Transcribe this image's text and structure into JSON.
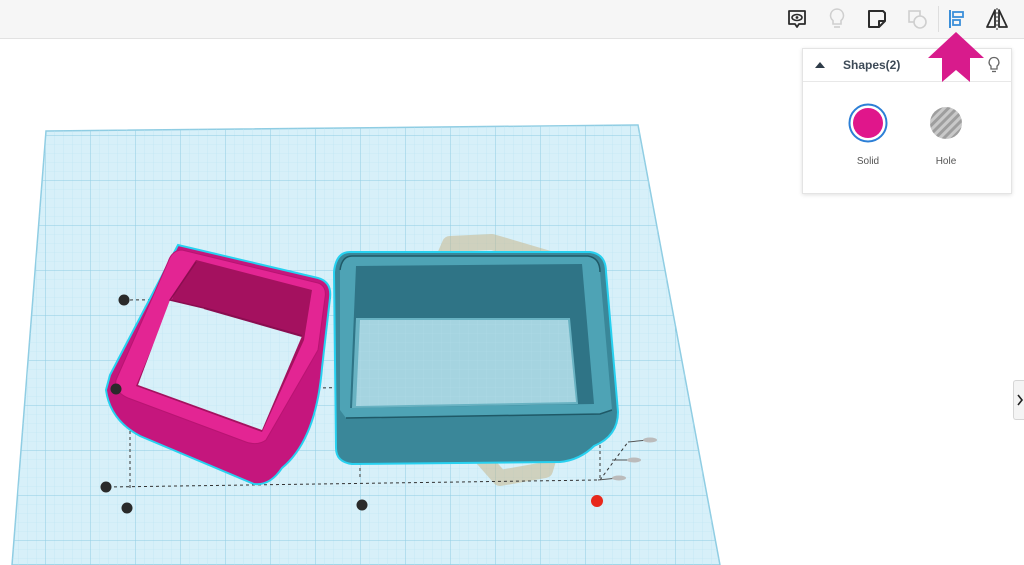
{
  "toolbar": {
    "buttons": [
      {
        "name": "view-toggle-icon",
        "enabled": true
      },
      {
        "name": "lightbulb-icon",
        "enabled": false
      },
      {
        "name": "note-icon",
        "enabled": true
      },
      {
        "name": "group-icon",
        "enabled": false
      },
      {
        "name": "align-icon",
        "enabled": true,
        "active": true
      },
      {
        "name": "mirror-icon",
        "enabled": true
      }
    ]
  },
  "inspector": {
    "title": "Shapes(2)",
    "solid_label": "Solid",
    "hole_label": "Hole",
    "solid_color": "#e0168b"
  },
  "colors": {
    "accent": "#e0168b",
    "grid": "#9fd8ea",
    "teal_shape": "#3f8ea0",
    "selection_outline": "#27d1f0"
  }
}
